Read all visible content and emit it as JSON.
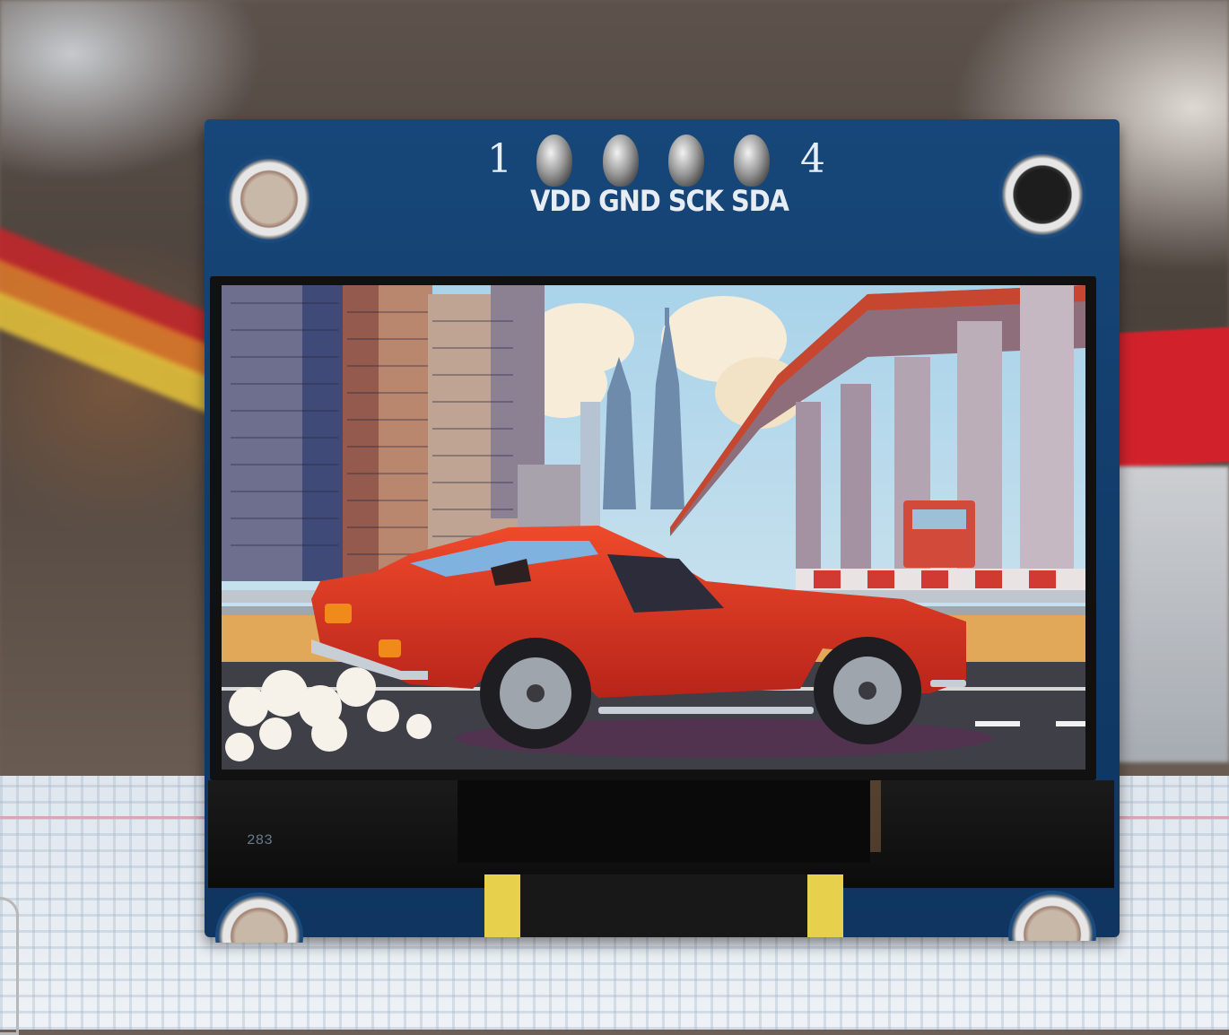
{
  "module": {
    "pin_start": "1",
    "pin_end": "4",
    "pin_labels": "VDD GND SCK SDA",
    "code": "283"
  },
  "colors": {
    "pcb": "#17477a",
    "car": "#d8301e",
    "sky": "#a9d3ea"
  }
}
